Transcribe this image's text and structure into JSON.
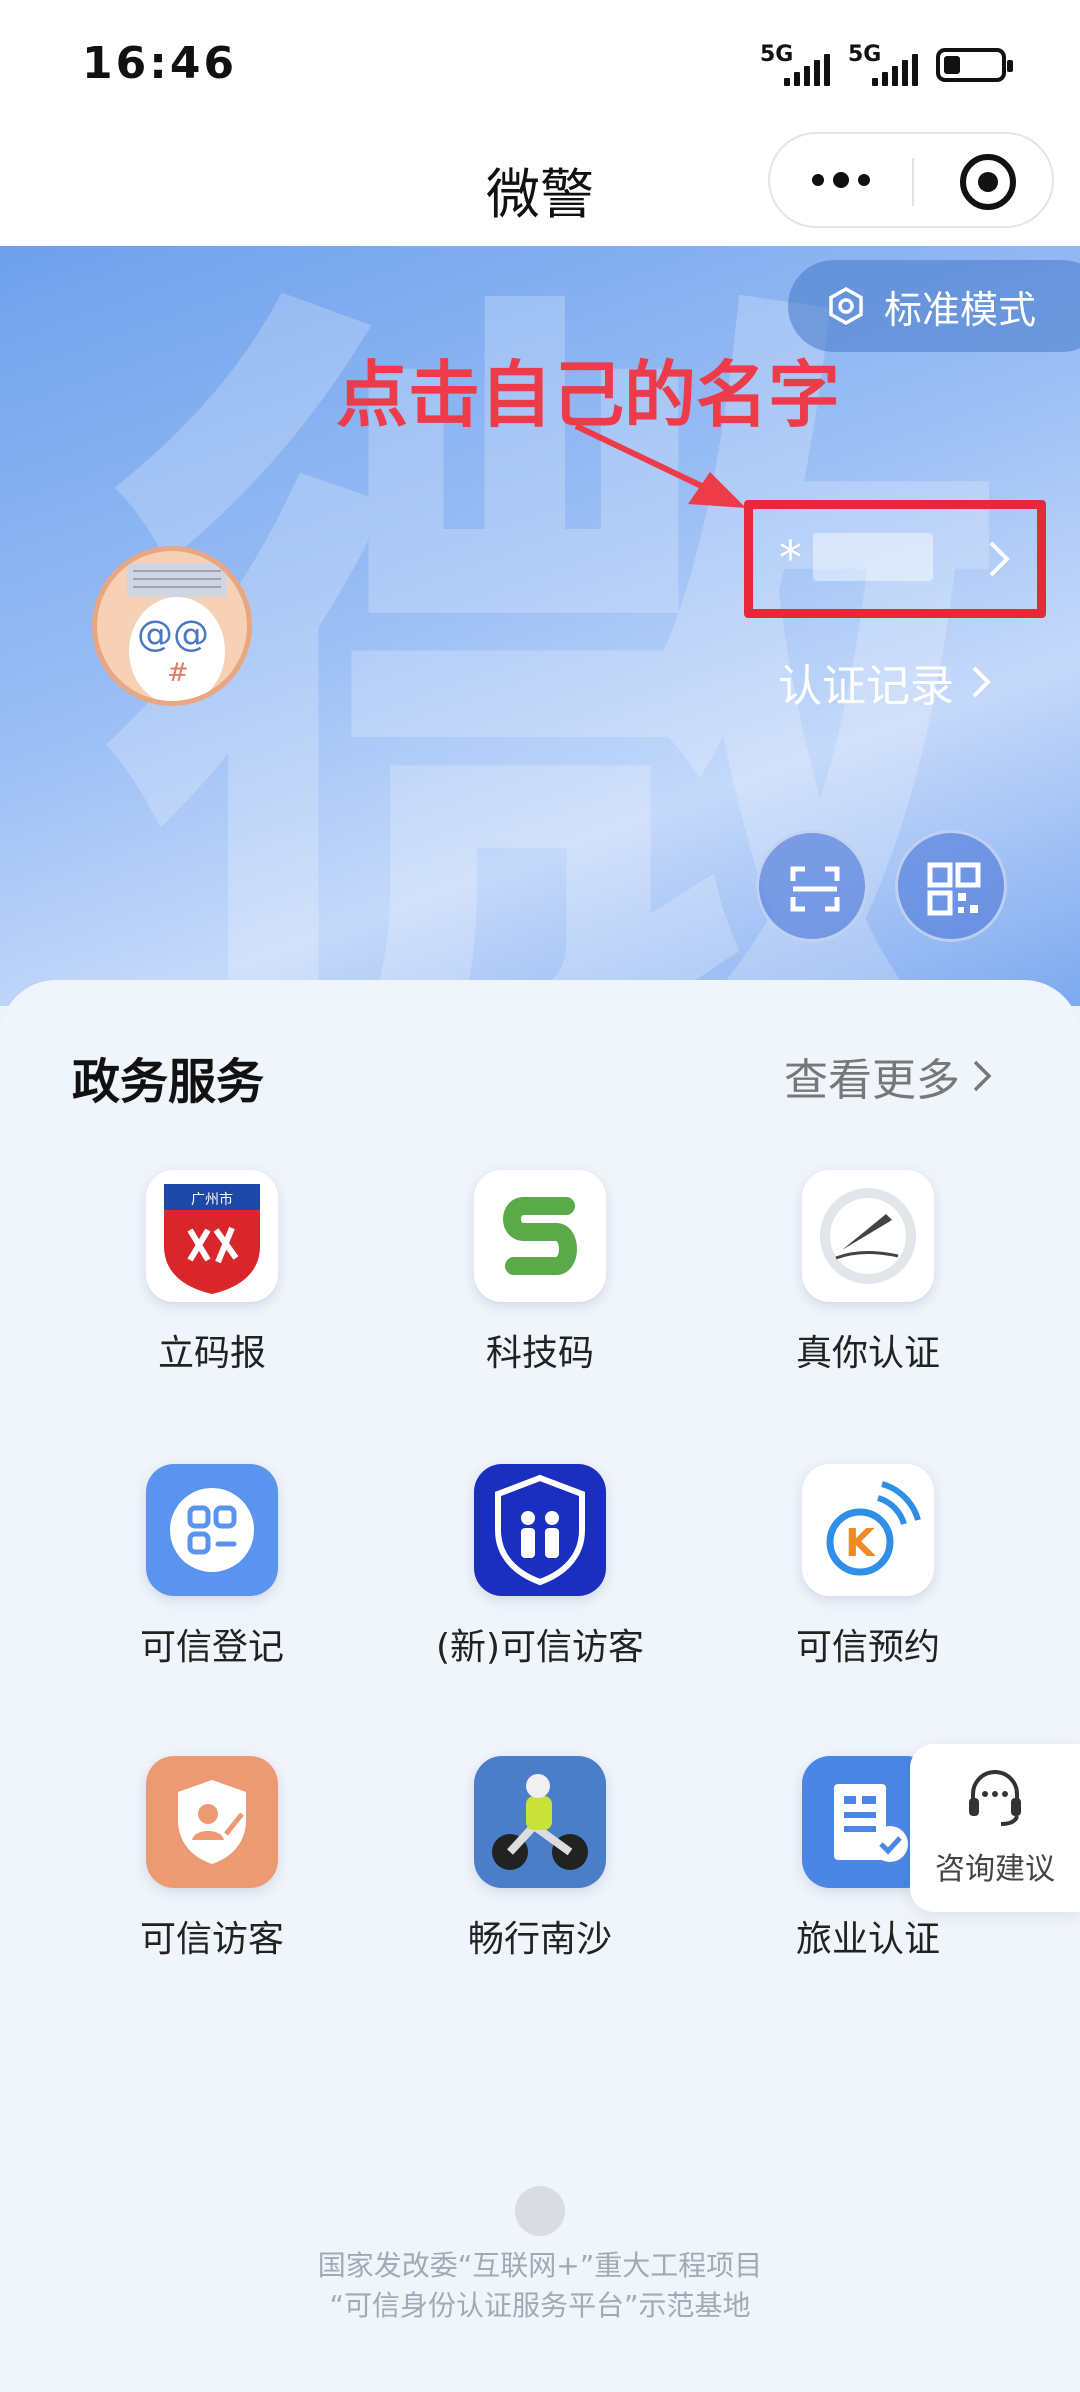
{
  "status_bar": {
    "time": "16:46",
    "signal_1_label": "5G",
    "signal_2_label": "5G"
  },
  "title_bar": {
    "title": "微警"
  },
  "hero": {
    "watermark": "微",
    "mode_button_label": "标准模式",
    "annotation": "点击自己的名字",
    "user_name": "*",
    "certification_record_label": "认证记录"
  },
  "services": {
    "title": "政务服务",
    "more_label": "查看更多",
    "items": [
      {
        "label": "立码报",
        "icon": "guangzhou-shield-icon",
        "badge_text": "广州市"
      },
      {
        "label": "科技码",
        "icon": "green-s-logo-icon"
      },
      {
        "label": "真你认证",
        "icon": "pen-seal-icon"
      },
      {
        "label": "可信登记",
        "icon": "grid-app-icon"
      },
      {
        "label": "(新)可信访客",
        "icon": "blue-shield-people-icon"
      },
      {
        "label": "可信预约",
        "icon": "k-signal-icon"
      },
      {
        "label": "可信访客",
        "icon": "orange-shield-icon"
      },
      {
        "label": "畅行南沙",
        "icon": "motorcycle-police-icon"
      },
      {
        "label": "旅业认证",
        "icon": "building-check-icon"
      }
    ]
  },
  "consult": {
    "label": "咨询建议"
  },
  "footer": {
    "line1": "国家发改委“互联网+”重大工程项目",
    "line2": "“可信身份认证服务平台”示范基地"
  },
  "colors": {
    "annotation_red": "#ee3b4a",
    "highlight_box": "#e8283a",
    "hero_blue": "#7da9ef"
  }
}
